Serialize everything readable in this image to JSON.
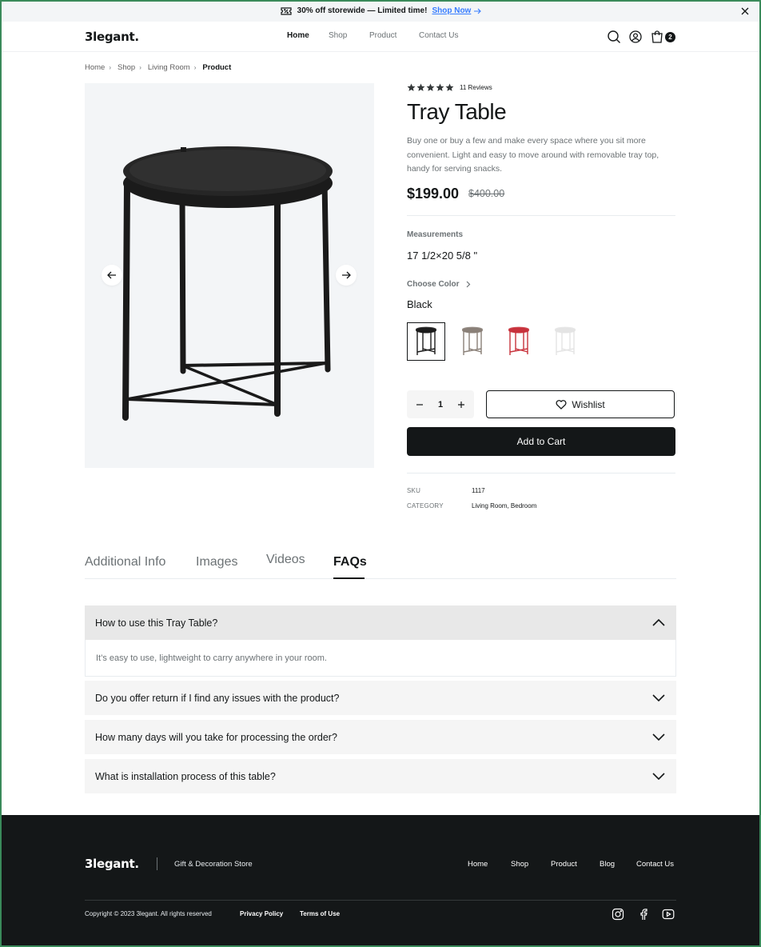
{
  "banner": {
    "message": "30% off storewide — Limited time!",
    "link": "Shop Now",
    "icon": "ticket-icon"
  },
  "nav": {
    "logo": "3legant.",
    "links": [
      "Home",
      "Shop",
      "Product",
      "Contact Us"
    ],
    "active": "Home",
    "cart_count": "2"
  },
  "breadcrumb": [
    "Home",
    "Shop",
    "Living Room",
    "Product"
  ],
  "product": {
    "rating": 5,
    "reviews": "11 Reviews",
    "title": "Tray Table",
    "description": "Buy one or buy a few and make every space where you sit more convenient. Light and easy to move around with removable tray top, handy for serving snacks.",
    "price": "$199.00",
    "old_price": "$400.00",
    "measurements_label": "Measurements",
    "measurements": "17 1/2×20 5/8 \"",
    "choose_color_label": "Choose Color",
    "color": "Black",
    "swatches": [
      {
        "name": "Black",
        "color": "#1c1c1c"
      },
      {
        "name": "Taupe",
        "color": "#8a8078"
      },
      {
        "name": "Red",
        "color": "#c8323c"
      },
      {
        "name": "White",
        "color": "#e4e4e4"
      }
    ],
    "quantity": "1",
    "wishlist_label": "Wishlist",
    "add_to_cart_label": "Add to Cart",
    "sku_label": "SKU",
    "sku": "1117",
    "category_label": "CATEGORY",
    "category": "Living Room, Bedroom"
  },
  "tabs": [
    "Additional Info",
    "Images",
    "Videos",
    "FAQs"
  ],
  "active_tab": "FAQs",
  "faqs": [
    {
      "q": "How to use this Tray Table?",
      "a": "It’s easy to use, lightweight to carry anywhere in your room.",
      "open": true
    },
    {
      "q": "Do you offer return if I find any issues with the product?",
      "open": false
    },
    {
      "q": "How many days will you take for processing the order?",
      "open": false
    },
    {
      "q": "What is installation process of this table?",
      "open": false
    }
  ],
  "footer": {
    "logo": "3legant.",
    "tagline": "Gift & Decoration Store",
    "links": [
      "Home",
      "Shop",
      "Product",
      "Blog",
      "Contact Us"
    ],
    "copyright": "Copyright © 2023 3legant. All rights reserved",
    "privacy": "Privacy Policy",
    "terms": "Terms of Use",
    "social": [
      "instagram-icon",
      "facebook-icon",
      "youtube-icon"
    ]
  }
}
